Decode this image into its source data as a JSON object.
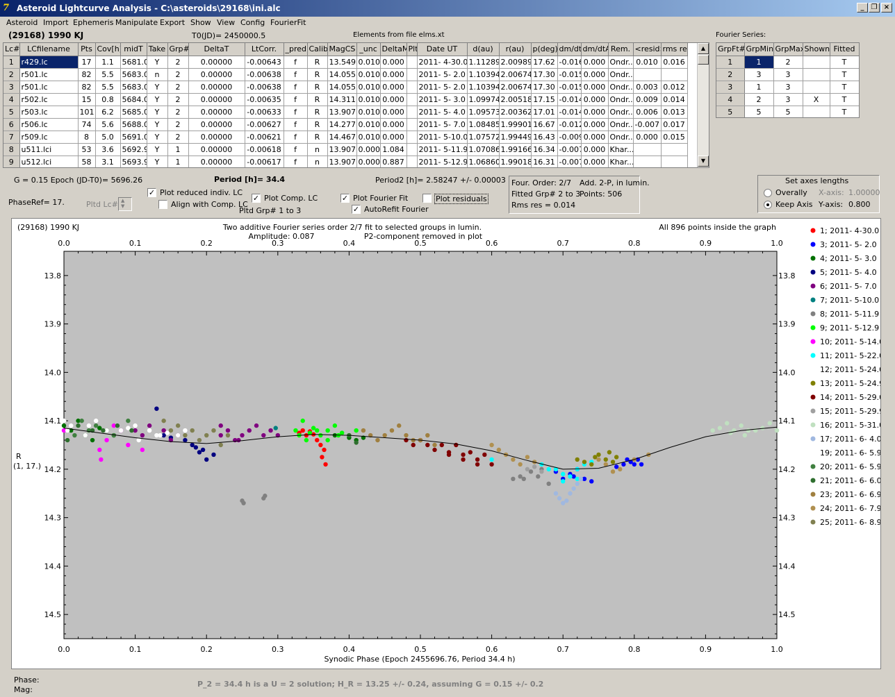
{
  "window": {
    "title": "Asteroid Lightcurve Analysis - C:\\asteroids\\29168\\ini.alc",
    "buttons": {
      "minimize": "_",
      "restore": "❐",
      "close": "×"
    }
  },
  "menu": [
    "Asteroid",
    "Import",
    "Ephemeris",
    "Manipulate",
    "Export",
    "Show",
    "View",
    "Config",
    "FourierFit"
  ],
  "header": {
    "asteroid": "(29168) 1990 KJ",
    "t0": "T0(JD)= 2450000.5",
    "elements": "Elements from file elms.xt",
    "fourier_series_label": "Fourier Series:"
  },
  "lc_table": {
    "columns": [
      "Lc#",
      "LCfilename",
      "Pts",
      "Cov[h]",
      "midT",
      "Take",
      "Grp#",
      "DeltaT",
      "LtCorr.",
      "_pred",
      "Calib",
      "MagCS",
      "_unc",
      "DeltaM",
      "Plt",
      "Date UT",
      "d(au)",
      "r(au)",
      "p(deg)",
      "dm/dt",
      "dm/dtA",
      "Rem.",
      "<resid>",
      "rms res"
    ],
    "rows": [
      [
        "1",
        "r429.lc",
        "17",
        "1.1",
        "5681.0",
        "Y",
        "2",
        "0.00000",
        "-0.00643",
        "f",
        "R",
        "13.549",
        "0.010",
        "0.000",
        "",
        "2011- 4-30.0",
        "1.11289",
        "2.00989",
        "17.62",
        "-0.016",
        "0.000",
        "Ondr...",
        "0.010",
        "0.016"
      ],
      [
        "2",
        "r501.lc",
        "82",
        "5.5",
        "5683.0",
        "n",
        "2",
        "0.00000",
        "-0.00638",
        "f",
        "R",
        "14.055",
        "0.010",
        "0.000",
        "",
        "2011- 5- 2.0",
        "1.10394",
        "2.00674",
        "17.30",
        "-0.015",
        "0.000",
        "Ondr...",
        "",
        ""
      ],
      [
        "3",
        "r501.lc",
        "82",
        "5.5",
        "5683.0",
        "Y",
        "2",
        "0.00000",
        "-0.00638",
        "f",
        "R",
        "14.055",
        "0.010",
        "0.000",
        "",
        "2011- 5- 2.0",
        "1.10394",
        "2.00674",
        "17.30",
        "-0.015",
        "0.000",
        "Ondr...",
        "0.003",
        "0.012"
      ],
      [
        "4",
        "r502.lc",
        "15",
        "0.8",
        "5684.0",
        "Y",
        "2",
        "0.00000",
        "-0.00635",
        "f",
        "R",
        "14.311",
        "0.010",
        "0.000",
        "",
        "2011- 5- 3.0",
        "1.09974",
        "2.00518",
        "17.15",
        "-0.014",
        "0.000",
        "Ondr...",
        "0.009",
        "0.014"
      ],
      [
        "5",
        "r503.lc",
        "101",
        "6.2",
        "5685.0",
        "Y",
        "2",
        "0.00000",
        "-0.00633",
        "f",
        "R",
        "13.907",
        "0.010",
        "0.000",
        "",
        "2011- 5- 4.0",
        "1.09573",
        "2.00362",
        "17.01",
        "-0.014",
        "0.000",
        "Ondr...",
        "0.006",
        "0.013"
      ],
      [
        "6",
        "r506.lc",
        "74",
        "5.6",
        "5688.0",
        "Y",
        "2",
        "0.00000",
        "-0.00627",
        "f",
        "R",
        "14.277",
        "0.010",
        "0.000",
        "",
        "2011- 5- 7.0",
        "1.08485",
        "1.99901",
        "16.67",
        "-0.012",
        "0.000",
        "Ondr...",
        "-0.007",
        "0.017"
      ],
      [
        "7",
        "r509.lc",
        "8",
        "5.0",
        "5691.0",
        "Y",
        "2",
        "0.00000",
        "-0.00621",
        "f",
        "R",
        "14.467",
        "0.010",
        "0.000",
        "",
        "2011- 5-10.0",
        "1.07572",
        "1.99449",
        "16.43",
        "-0.009",
        "0.000",
        "Ondr...",
        "0.000",
        "0.015"
      ],
      [
        "8",
        "u511.lci",
        "53",
        "3.6",
        "5692.9",
        "Y",
        "1",
        "0.00000",
        "-0.00618",
        "f",
        "n",
        "13.907",
        "0.000",
        "1.084",
        "",
        "2011- 5-11.9",
        "1.07086",
        "1.99166",
        "16.34",
        "-0.007",
        "0.000",
        "Khar...",
        "",
        ""
      ],
      [
        "9",
        "u512.lci",
        "58",
        "3.1",
        "5693.9",
        "Y",
        "1",
        "0.00000",
        "-0.00617",
        "f",
        "n",
        "13.907",
        "0.000",
        "0.887",
        "",
        "2011- 5-12.9",
        "1.06860",
        "1.99018",
        "16.31",
        "-0.007",
        "0.000",
        "Khar...",
        "",
        ""
      ]
    ]
  },
  "fourier_table": {
    "columns": [
      "GrpFt#",
      "GrpMin",
      "GrpMax",
      "Shown",
      "Fitted"
    ],
    "rows": [
      [
        "1",
        "1",
        "2",
        "",
        "T"
      ],
      [
        "2",
        "3",
        "3",
        "",
        "T"
      ],
      [
        "3",
        "1",
        "3",
        "",
        "T"
      ],
      [
        "4",
        "2",
        "3",
        "X",
        "T"
      ],
      [
        "5",
        "5",
        "5",
        "",
        "T"
      ]
    ]
  },
  "controls": {
    "g_epoch": "G = 0.15   Epoch (JD-T0)= 5696.26",
    "period": "Period [h]= 34.4",
    "period2": "Period2 [h]= 2.58247 +/- 0.00003",
    "phaseref": "PhaseRef= 17.",
    "pltd_lc": "Pltd Lc#:",
    "pltd_grp": "Pltd Grp#  1   to   3",
    "plot_reduced": "Plot reduced indiv. LC",
    "align_comp": "Align with Comp. LC",
    "plot_comp": "Plot Comp. LC",
    "plot_fourier": "Plot Fourier Fit",
    "autorefit": "AutoRefit Fourier",
    "plot_residuals": "Plot residuals",
    "fit_info": {
      "order": "Four. Order:  2/7",
      "add": "Add. 2-P, in lumin.",
      "fitted": "Fitted Grp# 2 to 3",
      "points": "Points: 506",
      "rms": "Rms res     = 0.014"
    },
    "axes": {
      "title": "Set axes lengths",
      "overall": "Overally",
      "keep": "Keep Axis",
      "xaxis_label": "X-axis:",
      "xaxis_value": "1.00000",
      "yaxis_label": "Y-axis:",
      "yaxis_value": "0.800"
    }
  },
  "plot_header": {
    "left": "(29168) 1990 KJ",
    "center1": "Two additive Fourier series order 2/7 fit to selected groups in lumin.",
    "center2a": "Amplitude: 0.087",
    "center2b": "P2-component removed in plot",
    "right": "All 896 points inside the graph",
    "ylabel1": "R",
    "ylabel2": "(1, 17.)"
  },
  "chart_data": {
    "type": "scatter",
    "xlabel": "Synodic Phase (Epoch 2455696.76, Period 34.4 h)",
    "ylabel": "R",
    "xlim": [
      0,
      1
    ],
    "ylim": [
      13.75,
      14.55
    ],
    "x_ticks": [
      "0.0",
      "0.1",
      "0.2",
      "0.3",
      "0.4",
      "0.5",
      "0.6",
      "0.7",
      "0.8",
      "0.9",
      "1.0"
    ],
    "y_ticks": [
      "13.8",
      "13.9",
      "14.0",
      "14.1",
      "14.2",
      "14.3",
      "14.4",
      "14.5"
    ],
    "y_inverted": true,
    "fit_curve": [
      [
        0.0,
        14.115
      ],
      [
        0.05,
        14.125
      ],
      [
        0.1,
        14.135
      ],
      [
        0.15,
        14.143
      ],
      [
        0.2,
        14.147
      ],
      [
        0.25,
        14.141
      ],
      [
        0.3,
        14.133
      ],
      [
        0.35,
        14.128
      ],
      [
        0.4,
        14.13
      ],
      [
        0.45,
        14.135
      ],
      [
        0.5,
        14.14
      ],
      [
        0.55,
        14.148
      ],
      [
        0.6,
        14.162
      ],
      [
        0.65,
        14.182
      ],
      [
        0.7,
        14.2
      ],
      [
        0.75,
        14.198
      ],
      [
        0.8,
        14.18
      ],
      [
        0.85,
        14.155
      ],
      [
        0.9,
        14.133
      ],
      [
        0.95,
        14.12
      ],
      [
        1.0,
        14.113
      ]
    ],
    "series": [
      {
        "name": "1; 2011- 4-30.0",
        "color": "#ff0000",
        "x": [
          0.33,
          0.335,
          0.34,
          0.345,
          0.35,
          0.355,
          0.36,
          0.365,
          0.367,
          0.362
        ],
        "y": [
          14.125,
          14.12,
          14.13,
          14.122,
          14.128,
          14.14,
          14.15,
          14.16,
          14.19,
          14.175
        ]
      },
      {
        "name": "3; 2011- 5- 2.0",
        "color": "#0000ff",
        "x": [
          0.69,
          0.7,
          0.71,
          0.715,
          0.72,
          0.73,
          0.74,
          0.785,
          0.79,
          0.795,
          0.8,
          0.805,
          0.81,
          0.775
        ],
        "y": [
          14.205,
          14.22,
          14.21,
          14.215,
          14.2,
          14.22,
          14.225,
          14.19,
          14.18,
          14.185,
          14.19,
          14.18,
          14.19,
          14.195
        ]
      },
      {
        "name": "4; 2011- 5- 3.0",
        "color": "#007000",
        "x": [
          0.0,
          0.01,
          0.02,
          0.03,
          0.04,
          0.05,
          0.06,
          0.07,
          0.38,
          0.4,
          0.41,
          0.42
        ],
        "y": [
          14.11,
          14.12,
          14.1,
          14.13,
          14.14,
          14.115,
          14.12,
          14.13,
          14.13,
          14.135,
          14.14,
          14.135
        ]
      },
      {
        "name": "5; 2011- 5- 4.0",
        "color": "#000080",
        "x": [
          0.13,
          0.14,
          0.15,
          0.17,
          0.18,
          0.19,
          0.2,
          0.21,
          0.195,
          0.185
        ],
        "y": [
          14.075,
          14.13,
          14.135,
          14.14,
          14.15,
          14.165,
          14.18,
          14.17,
          14.16,
          14.155
        ]
      },
      {
        "name": "6; 2011- 5- 7.0",
        "color": "#800080",
        "x": [
          0.1,
          0.11,
          0.12,
          0.14,
          0.15,
          0.16,
          0.22,
          0.23,
          0.24,
          0.25,
          0.26,
          0.27,
          0.28,
          0.29,
          0.3,
          0.22,
          0.245
        ],
        "y": [
          14.12,
          14.13,
          14.11,
          14.12,
          14.14,
          14.13,
          14.13,
          14.12,
          14.14,
          14.13,
          14.12,
          14.11,
          14.13,
          14.12,
          14.13,
          14.11,
          14.14
        ]
      },
      {
        "name": "7; 2011- 5-10.0",
        "color": "#008080",
        "x": [
          0.297
        ],
        "y": [
          14.115
        ]
      },
      {
        "name": "8; 2011- 5-11.9",
        "color": "#808080",
        "x": [
          0.25,
          0.252,
          0.28,
          0.282,
          0.63,
          0.64,
          0.645,
          0.655,
          0.665,
          0.67,
          0.68
        ],
        "y": [
          14.265,
          14.27,
          14.26,
          14.255,
          14.22,
          14.215,
          14.22,
          14.205,
          14.215,
          14.2,
          14.23
        ]
      },
      {
        "name": "9; 2011- 5-12.9",
        "color": "#00ff00",
        "x": [
          0.325,
          0.33,
          0.335,
          0.34,
          0.345,
          0.35,
          0.355,
          0.36,
          0.37,
          0.38,
          0.39,
          0.4,
          0.41,
          0.37,
          0.385
        ],
        "y": [
          14.12,
          14.13,
          14.1,
          14.14,
          14.125,
          14.115,
          14.12,
          14.13,
          14.12,
          14.11,
          14.125,
          14.13,
          14.12,
          14.14,
          14.13
        ]
      },
      {
        "name": "10; 2011- 5-14.0",
        "color": "#ff00ff",
        "x": [
          0.0,
          0.05,
          0.052,
          0.06,
          0.07,
          0.08,
          0.09,
          0.11
        ],
        "y": [
          14.12,
          14.16,
          14.18,
          14.14,
          14.11,
          14.12,
          14.15,
          14.16
        ]
      },
      {
        "name": "11; 2011- 5-22.0",
        "color": "#00ffff",
        "x": [
          0.6,
          0.67,
          0.68,
          0.69,
          0.7,
          0.71,
          0.72,
          0.73,
          0.74,
          0.7,
          0.72
        ],
        "y": [
          14.18,
          14.19,
          14.2,
          14.2,
          14.21,
          14.215,
          14.2,
          14.19,
          14.185,
          14.225,
          14.22
        ]
      },
      {
        "name": "12; 2011- 5-24.0",
        "color": "#ffffff",
        "x": [
          0.0,
          0.005,
          0.01,
          0.03,
          0.06,
          0.08,
          0.1,
          0.105,
          0.12,
          0.13,
          0.145,
          0.16
        ],
        "y": [
          14.1,
          14.12,
          14.11,
          14.13,
          14.12,
          14.12,
          14.11,
          14.14,
          14.12,
          14.13,
          14.125,
          14.13
        ]
      },
      {
        "name": "13; 2011- 5-24.9",
        "color": "#808000",
        "x": [
          0.72,
          0.73,
          0.74,
          0.745,
          0.75,
          0.76,
          0.765,
          0.77,
          0.775
        ],
        "y": [
          14.18,
          14.185,
          14.19,
          14.175,
          14.17,
          14.18,
          14.165,
          14.185,
          14.175
        ]
      },
      {
        "name": "14; 2011- 5-29.0",
        "color": "#800000",
        "x": [
          0.48,
          0.49,
          0.5,
          0.51,
          0.52,
          0.53,
          0.54,
          0.55,
          0.56,
          0.57,
          0.58,
          0.59,
          0.6,
          0.54,
          0.56,
          0.58
        ],
        "y": [
          14.14,
          14.15,
          14.14,
          14.15,
          14.16,
          14.15,
          14.17,
          14.15,
          14.17,
          14.165,
          14.18,
          14.17,
          14.19,
          14.165,
          14.18,
          14.19
        ]
      },
      {
        "name": "15; 2011- 5-29.9",
        "color": "#a0a0a0",
        "x": [
          0.65,
          0.66,
          0.67
        ],
        "y": [
          14.2,
          14.195,
          14.205
        ]
      },
      {
        "name": "16; 2011- 5-31.0",
        "color": "#c0e0c0",
        "x": [
          0.91,
          0.92,
          0.93,
          0.94,
          0.95,
          0.96,
          0.97,
          0.98,
          0.99,
          1.0,
          0.935,
          0.955
        ],
        "y": [
          14.12,
          14.115,
          14.105,
          14.12,
          14.11,
          14.12,
          14.12,
          14.115,
          14.105,
          14.12,
          14.125,
          14.13
        ]
      },
      {
        "name": "17; 2011- 6- 4.0",
        "color": "#a0b8e0",
        "x": [
          0.69,
          0.695,
          0.7,
          0.705,
          0.71,
          0.715,
          0.72,
          0.725
        ],
        "y": [
          14.25,
          14.26,
          14.27,
          14.265,
          14.25,
          14.24,
          14.23,
          14.22
        ]
      },
      {
        "name": "19; 2011- 6- 5.9",
        "color": "#ffffff",
        "x": [
          0.035,
          0.045,
          0.09,
          0.135,
          0.17
        ],
        "y": [
          14.11,
          14.1,
          14.115,
          14.13,
          14.12
        ]
      },
      {
        "name": "20; 2011- 6- 5.9",
        "color": "#408040",
        "x": [
          0.015,
          0.025,
          0.035,
          0.045,
          0.07,
          0.09
        ],
        "y": [
          14.13,
          14.1,
          14.12,
          14.11,
          14.13,
          14.1
        ]
      },
      {
        "name": "21; 2011- 6- 6.0",
        "color": "#2f6f2f",
        "x": [
          0.005,
          0.02,
          0.04,
          0.055,
          0.075,
          0.095,
          0.4,
          0.41
        ],
        "y": [
          14.14,
          14.11,
          14.12,
          14.12,
          14.11,
          14.12,
          14.13,
          14.145
        ]
      },
      {
        "name": "23; 2011- 6- 6.9",
        "color": "#a08040",
        "x": [
          0.42,
          0.43,
          0.44,
          0.45,
          0.46,
          0.47,
          0.48,
          0.49,
          0.5,
          0.51,
          0.52
        ],
        "y": [
          14.12,
          14.13,
          14.14,
          14.13,
          14.12,
          14.11,
          14.13,
          14.14,
          14.14,
          14.13,
          14.15
        ]
      },
      {
        "name": "24; 2011- 6- 7.9",
        "color": "#b09050",
        "x": [
          0.6,
          0.61,
          0.62,
          0.63,
          0.64,
          0.65,
          0.66,
          0.75,
          0.76,
          0.77,
          0.78,
          0.8,
          0.82
        ],
        "y": [
          14.15,
          14.16,
          14.17,
          14.18,
          14.19,
          14.175,
          14.185,
          14.18,
          14.19,
          14.205,
          14.2,
          14.18,
          14.17
        ]
      },
      {
        "name": "25; 2011- 6- 8.9",
        "color": "#808050",
        "x": [
          0.14,
          0.15,
          0.16,
          0.17,
          0.18,
          0.19,
          0.2,
          0.21,
          0.22,
          0.23
        ],
        "y": [
          14.1,
          14.12,
          14.11,
          14.13,
          14.12,
          14.14,
          14.13,
          14.12,
          14.15,
          14.13
        ]
      }
    ]
  },
  "status": {
    "phase_label": "Phase:",
    "mag_label": "Mag:",
    "message": "P_2 = 34.4 h is a U = 2 solution; H_R = 13.25 +/- 0.24, assuming G = 0.15 +/- 0.2"
  }
}
